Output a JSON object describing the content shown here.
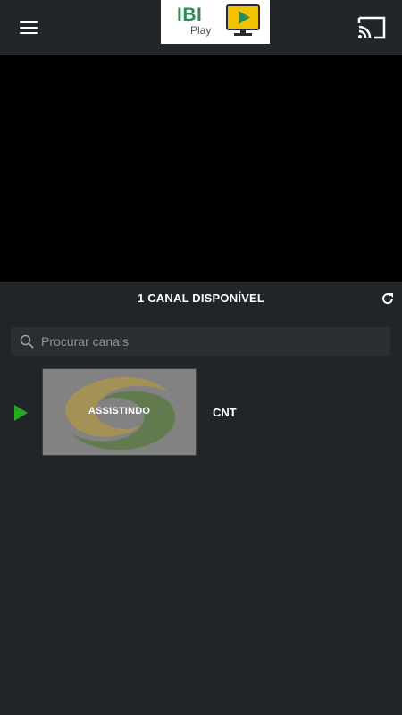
{
  "header": {
    "menu_icon": "hamburger-menu-icon",
    "logo_text": "IBI",
    "logo_subtext": "Play",
    "cast_icon": "cast-icon",
    "colors": {
      "logo_green": "#2e8b57",
      "logo_yellow": "#f2c200",
      "bar_bg": "#232629"
    }
  },
  "player": {
    "background": "#000000"
  },
  "channels": {
    "count_label": "1 CANAL DISPONÍVEL",
    "refresh_icon": "refresh-icon",
    "search": {
      "placeholder": "Procurar canais",
      "value": "",
      "icon": "search-icon"
    },
    "items": [
      {
        "name": "CNT",
        "status": "ASSISTINDO",
        "playing": true,
        "indicator_color": "#27a822"
      }
    ]
  }
}
